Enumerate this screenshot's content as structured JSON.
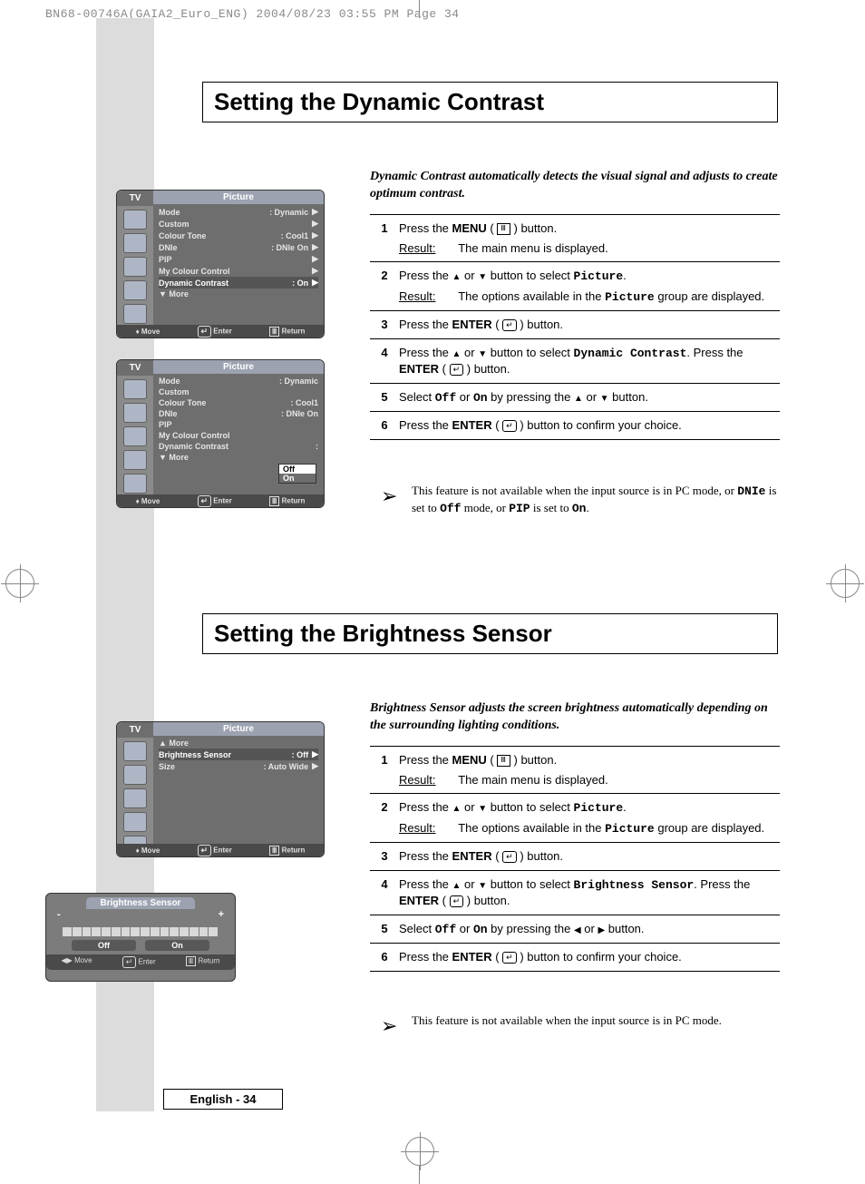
{
  "header_marks": "BN68-00746A(GAIA2_Euro_ENG)  2004/08/23  03:55 PM  Page 34",
  "section1": {
    "title": "Setting the Dynamic Contrast",
    "intro": "Dynamic Contrast automatically detects the visual signal and adjusts to create optimum contrast.",
    "steps": [
      {
        "num": "1",
        "main": "Press the MENU ( ⠿ ) button.",
        "result": "The main menu is displayed."
      },
      {
        "num": "2",
        "main": "Press the ▲ or ▼ button to select Picture.",
        "result": "The options available in the Picture group are displayed."
      },
      {
        "num": "3",
        "main": "Press the ENTER ( ↵ ) button."
      },
      {
        "num": "4",
        "main": "Press the ▲ or ▼ button to select Dynamic Contrast. Press the ENTER ( ↵ ) button."
      },
      {
        "num": "5",
        "main": "Select Off or On by pressing the ▲ or ▼ button."
      },
      {
        "num": "6",
        "main": "Press the ENTER ( ↵ ) button to confirm your choice."
      }
    ],
    "note": "This feature is not available when the input source is in PC mode, or DNIe is set to Off mode, or PIP is set to On."
  },
  "section2": {
    "title": "Setting the Brightness Sensor",
    "intro": "Brightness Sensor adjusts the screen brightness automatically depending on the surrounding lighting conditions.",
    "steps": [
      {
        "num": "1",
        "main": "Press the MENU ( ⠿ ) button.",
        "result": "The main menu is displayed."
      },
      {
        "num": "2",
        "main": "Press the ▲ or ▼ button to select Picture.",
        "result": "The options available in the Picture group are displayed."
      },
      {
        "num": "3",
        "main": "Press the ENTER ( ↵ ) button."
      },
      {
        "num": "4",
        "main": "Press the ▲ or ▼ button to select Brightness Sensor. Press the ENTER ( ↵ ) button."
      },
      {
        "num": "5",
        "main": "Select Off or On by pressing the ◀ or ▶ button."
      },
      {
        "num": "6",
        "main": "Press the ENTER ( ↵ ) button to confirm your choice."
      }
    ],
    "note": "This feature is not available when the input source is in PC mode."
  },
  "osd": {
    "tv_label": "TV",
    "menu_title": "Picture",
    "screen1": [
      {
        "label": "Mode",
        "value": ": Dynamic",
        "arrow": true
      },
      {
        "label": "Custom",
        "value": "",
        "arrow": true
      },
      {
        "label": "Colour Tone",
        "value": ": Cool1",
        "arrow": true
      },
      {
        "label": "DNIe",
        "value": ": DNIe On",
        "arrow": true
      },
      {
        "label": "PIP",
        "value": "",
        "arrow": true
      },
      {
        "label": "My Colour Control",
        "value": "",
        "arrow": true
      },
      {
        "label": "Dynamic Contrast",
        "value": ": On",
        "arrow": true,
        "highlight": true
      },
      {
        "label": "▼ More",
        "value": "",
        "arrow": false
      }
    ],
    "screen2": [
      {
        "label": "Mode",
        "value": ": Dynamic"
      },
      {
        "label": "Custom",
        "value": ""
      },
      {
        "label": "Colour Tone",
        "value": ": Cool1"
      },
      {
        "label": "DNIe",
        "value": ": DNIe On"
      },
      {
        "label": "PIP",
        "value": ""
      },
      {
        "label": "My Colour Control",
        "value": ""
      },
      {
        "label": "Dynamic Contrast",
        "value": ":"
      },
      {
        "label": "▼ More",
        "value": ""
      }
    ],
    "screen2_options": {
      "items": [
        "Off",
        "On"
      ],
      "selected": "On"
    },
    "screen3": [
      {
        "label": "▲ More",
        "value": ""
      },
      {
        "label": "Brightness Sensor",
        "value": ": Off",
        "arrow": true,
        "highlight": true
      },
      {
        "label": "Size",
        "value": ": Auto Wide",
        "arrow": true
      }
    ],
    "footer": {
      "move": "Move",
      "enter": "Enter",
      "return": "Return"
    },
    "bs_dialog": {
      "title": "Brightness Sensor",
      "minus": "-",
      "plus": "+",
      "off": "Off",
      "on": "On",
      "move": "Move",
      "enter": "Enter",
      "return": "Return"
    }
  },
  "labels": {
    "result": "Result:",
    "page_number": "English - 34"
  }
}
